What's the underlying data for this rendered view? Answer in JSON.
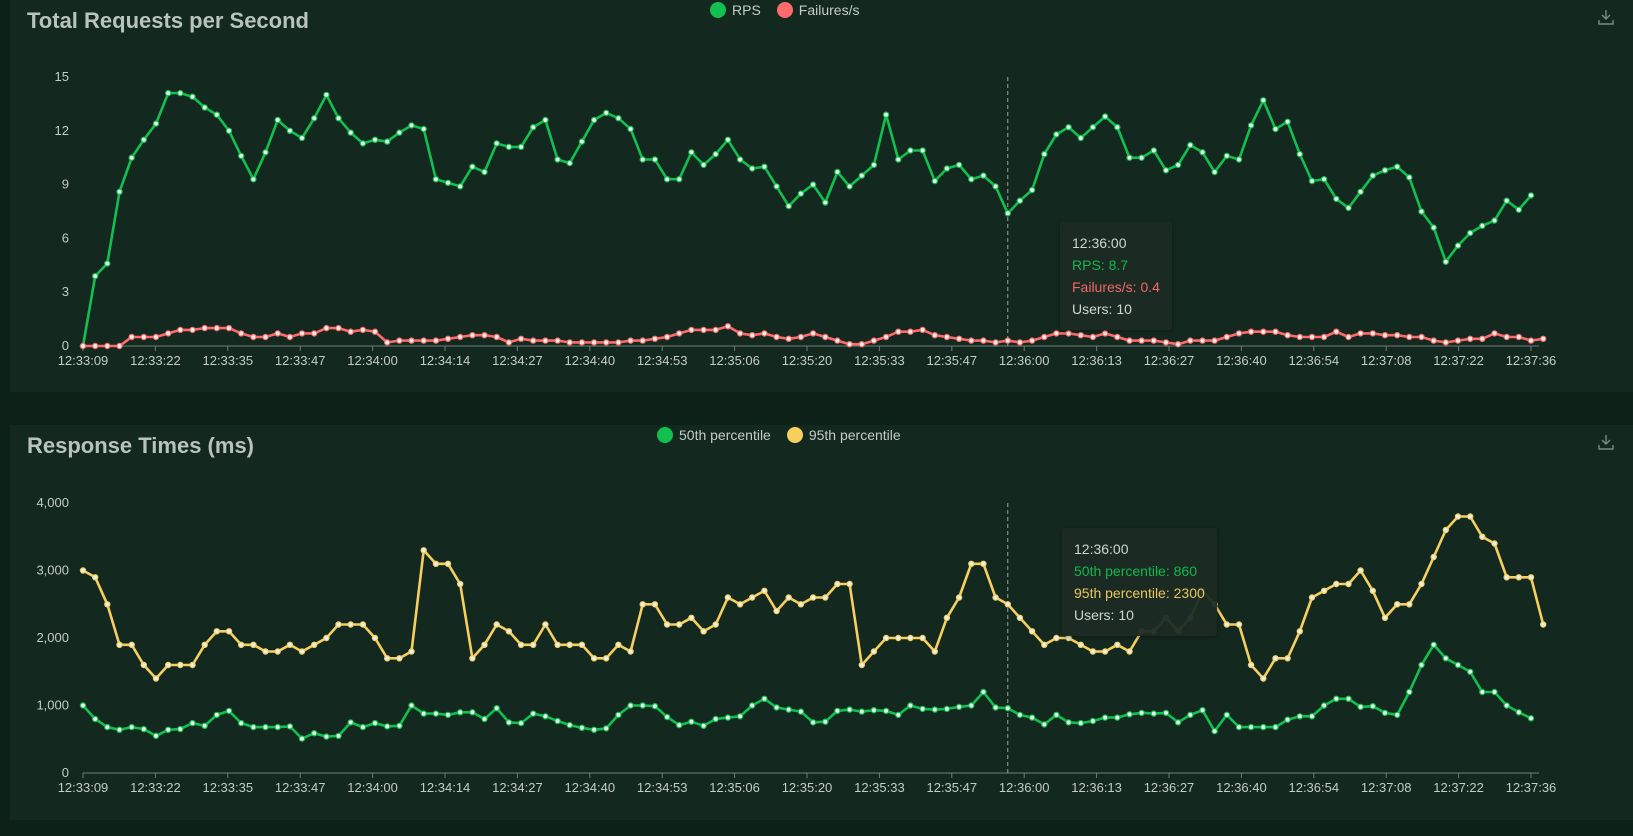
{
  "colors": {
    "rps": "#11c04f",
    "failures": "#ff6b6b",
    "p50": "#11c04f",
    "p95": "#f6cf5e"
  },
  "download_icon": "download-icon",
  "charts": {
    "rps_title": "Total Requests per Second",
    "rt_title": "Response Times (ms)",
    "rps_legend": [
      "RPS",
      "Failures/s"
    ],
    "rt_legend": [
      "50th percentile",
      "95th percentile"
    ]
  },
  "tooltip_rps": {
    "time": "12:36:00",
    "rps": "RPS: 8.7",
    "failures": "Failures/s: 0.4",
    "users": "Users: 10"
  },
  "tooltip_rt": {
    "time": "12:36:00",
    "p50": "50th percentile: 860",
    "p95": "95th percentile: 2300",
    "users": "Users: 10"
  },
  "chart_data": [
    {
      "type": "line",
      "title": "Total Requests per Second",
      "x_tick_labels": [
        "12:33:09",
        "12:33:22",
        "12:33:35",
        "12:33:47",
        "12:34:00",
        "12:34:14",
        "12:34:27",
        "12:34:40",
        "12:34:53",
        "12:35:06",
        "12:35:20",
        "12:35:33",
        "12:35:47",
        "12:36:00",
        "12:36:13",
        "12:36:27",
        "12:36:40",
        "12:36:54",
        "12:37:08",
        "12:37:22",
        "12:37:36"
      ],
      "ylim": [
        0,
        15
      ],
      "y_ticks": [
        0,
        3,
        6,
        9,
        12,
        15
      ],
      "legend_position": "top-center",
      "series": [
        {
          "name": "RPS",
          "values": [
            0,
            3.9,
            4.6,
            8.6,
            10.5,
            11.5,
            12.4,
            14.1,
            14.1,
            13.9,
            13.3,
            12.9,
            12.0,
            10.6,
            9.3,
            10.8,
            12.6,
            12.0,
            11.6,
            12.7,
            14.0,
            12.7,
            11.9,
            11.3,
            11.5,
            11.4,
            11.9,
            12.3,
            12.1,
            9.3,
            9.1,
            8.9,
            10.0,
            9.7,
            11.3,
            11.1,
            11.1,
            12.2,
            12.6,
            10.4,
            10.2,
            11.4,
            12.6,
            13.0,
            12.7,
            12.1,
            10.4,
            10.4,
            9.3,
            9.3,
            10.8,
            10.1,
            10.7,
            11.5,
            10.4,
            9.9,
            10.0,
            8.9,
            7.8,
            8.5,
            9.0,
            8.0,
            9.7,
            8.9,
            9.5,
            10.1,
            12.9,
            10.4,
            10.9,
            10.9,
            9.2,
            9.9,
            10.1,
            9.3,
            9.5,
            8.9,
            7.4,
            8.1,
            8.7,
            10.7,
            11.8,
            12.2,
            11.6,
            12.2,
            12.8,
            12.2,
            10.5,
            10.5,
            10.9,
            9.8,
            10.1,
            11.2,
            10.8,
            9.7,
            10.6,
            10.4,
            12.3,
            13.7,
            12.1,
            12.5,
            10.7,
            9.2,
            9.3,
            8.2,
            7.7,
            8.6,
            9.5,
            9.8,
            10.0,
            9.4,
            7.5,
            6.6,
            4.7,
            5.6,
            6.3,
            6.7,
            7.0,
            8.1,
            7.6,
            8.4
          ]
        },
        {
          "name": "Failures/s",
          "values": [
            0,
            0,
            0,
            0,
            0.5,
            0.5,
            0.5,
            0.7,
            0.9,
            0.9,
            1.0,
            1.0,
            1.0,
            0.7,
            0.5,
            0.5,
            0.7,
            0.5,
            0.7,
            0.7,
            1.0,
            1.0,
            0.8,
            0.9,
            0.8,
            0.2,
            0.3,
            0.3,
            0.3,
            0.3,
            0.4,
            0.5,
            0.6,
            0.6,
            0.5,
            0.2,
            0.4,
            0.3,
            0.3,
            0.3,
            0.2,
            0.2,
            0.2,
            0.2,
            0.2,
            0.3,
            0.3,
            0.4,
            0.5,
            0.7,
            0.9,
            0.9,
            0.9,
            1.1,
            0.7,
            0.6,
            0.7,
            0.5,
            0.4,
            0.5,
            0.7,
            0.5,
            0.3,
            0.1,
            0.1,
            0.3,
            0.5,
            0.8,
            0.8,
            0.9,
            0.6,
            0.5,
            0.4,
            0.3,
            0.3,
            0.2,
            0.3,
            0.2,
            0.3,
            0.5,
            0.7,
            0.7,
            0.6,
            0.5,
            0.7,
            0.5,
            0.3,
            0.3,
            0.3,
            0.2,
            0.1,
            0.3,
            0.3,
            0.3,
            0.5,
            0.7,
            0.8,
            0.8,
            0.8,
            0.6,
            0.5,
            0.5,
            0.5,
            0.8,
            0.5,
            0.7,
            0.7,
            0.6,
            0.6,
            0.5,
            0.5,
            0.3,
            0.2,
            0.3,
            0.4,
            0.4,
            0.7,
            0.5,
            0.5,
            0.3,
            0.4
          ]
        }
      ]
    },
    {
      "type": "line",
      "title": "Response Times (ms)",
      "x_tick_labels": [
        "12:33:09",
        "12:33:22",
        "12:33:35",
        "12:33:47",
        "12:34:00",
        "12:34:14",
        "12:34:27",
        "12:34:40",
        "12:34:53",
        "12:35:06",
        "12:35:20",
        "12:35:33",
        "12:35:47",
        "12:36:00",
        "12:36:13",
        "12:36:27",
        "12:36:40",
        "12:36:54",
        "12:37:08",
        "12:37:22",
        "12:37:36"
      ],
      "y_tick_labels": [
        "0",
        "1,000",
        "2,000",
        "3,000",
        "4,000"
      ],
      "ylim": [
        0,
        4000
      ],
      "y_ticks": [
        0,
        1000,
        2000,
        3000,
        4000
      ],
      "legend_position": "top-center",
      "series": [
        {
          "name": "50th percentile",
          "values": [
            1000,
            800,
            680,
            640,
            680,
            650,
            550,
            640,
            650,
            740,
            700,
            860,
            920,
            740,
            680,
            680,
            680,
            690,
            510,
            590,
            540,
            550,
            750,
            680,
            740,
            690,
            700,
            1000,
            880,
            880,
            860,
            900,
            900,
            800,
            960,
            750,
            740,
            880,
            840,
            770,
            710,
            670,
            640,
            660,
            860,
            1000,
            1000,
            990,
            830,
            710,
            760,
            700,
            800,
            820,
            840,
            1000,
            1100,
            970,
            940,
            910,
            750,
            760,
            920,
            940,
            910,
            930,
            920,
            860,
            1000,
            950,
            940,
            950,
            980,
            1000,
            1200,
            970,
            960,
            860,
            820,
            720,
            860,
            750,
            740,
            770,
            820,
            820,
            870,
            890,
            880,
            890,
            750,
            860,
            930,
            620,
            860,
            680,
            680,
            680,
            680,
            790,
            840,
            840,
            1000,
            1100,
            1100,
            980,
            990,
            890,
            860,
            1200,
            1600,
            1900,
            1700,
            1600,
            1500,
            1200,
            1200,
            1000,
            900,
            810
          ]
        },
        {
          "name": "95th percentile",
          "values": [
            3000,
            2900,
            2500,
            1900,
            1900,
            1600,
            1400,
            1600,
            1600,
            1600,
            1900,
            2100,
            2100,
            1900,
            1900,
            1800,
            1800,
            1900,
            1800,
            1900,
            2000,
            2200,
            2200,
            2200,
            2000,
            1700,
            1700,
            1800,
            3300,
            3100,
            3100,
            2800,
            1700,
            1900,
            2200,
            2100,
            1900,
            1900,
            2200,
            1900,
            1900,
            1900,
            1700,
            1700,
            1900,
            1800,
            2500,
            2500,
            2200,
            2200,
            2300,
            2100,
            2200,
            2600,
            2500,
            2600,
            2700,
            2400,
            2600,
            2500,
            2600,
            2600,
            2800,
            2800,
            1600,
            1800,
            2000,
            2000,
            2000,
            2000,
            1800,
            2300,
            2600,
            3100,
            3100,
            2600,
            2500,
            2300,
            2100,
            1900,
            2000,
            2000,
            1900,
            1800,
            1800,
            1900,
            1800,
            2100,
            2100,
            2300,
            2100,
            2300,
            2700,
            2500,
            2200,
            2200,
            1600,
            1400,
            1700,
            1700,
            2100,
            2600,
            2700,
            2800,
            2800,
            3000,
            2700,
            2300,
            2500,
            2500,
            2800,
            3200,
            3600,
            3800,
            3800,
            3500,
            3400,
            2900,
            2900,
            2900,
            2200
          ]
        }
      ]
    }
  ]
}
